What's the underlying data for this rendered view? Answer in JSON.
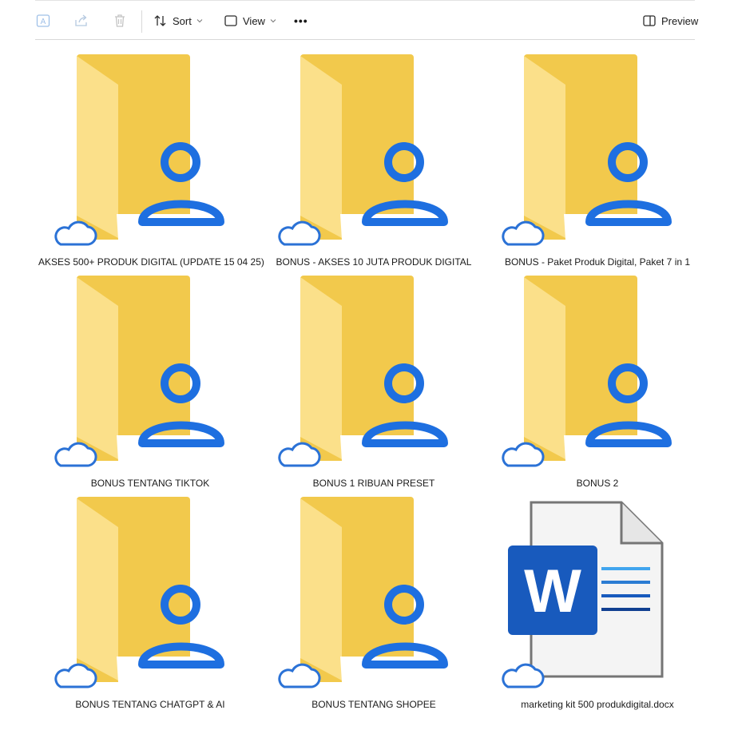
{
  "toolbar": {
    "rename_icon": "rename-icon",
    "share_icon": "share-icon",
    "delete_icon": "trash-icon",
    "sort_label": "Sort",
    "view_label": "View",
    "more_label": "•••",
    "preview_label": "Preview"
  },
  "items": [
    {
      "name": "AKSES 500+ PRODUK DIGITAL (UPDATE 15 04 25)",
      "type": "shared-folder",
      "status": "cloud"
    },
    {
      "name": "BONUS - AKSES 10 JUTA PRODUK DIGITAL",
      "type": "shared-folder",
      "status": "cloud"
    },
    {
      "name": "BONUS - Paket Produk Digital, Paket 7 in 1",
      "type": "shared-folder",
      "status": "cloud"
    },
    {
      "name": "BONUS  TENTANG TIKTOK",
      "type": "shared-folder",
      "status": "cloud"
    },
    {
      "name": "BONUS 1 RIBUAN PRESET",
      "type": "shared-folder",
      "status": "cloud"
    },
    {
      "name": "BONUS 2",
      "type": "shared-folder",
      "status": "cloud"
    },
    {
      "name": "BONUS TENTANG CHATGPT & AI",
      "type": "shared-folder",
      "status": "cloud"
    },
    {
      "name": "BONUS TENTANG SHOPEE",
      "type": "shared-folder",
      "status": "cloud"
    },
    {
      "name": "marketing kit 500 produkdigital.docx",
      "type": "word-document",
      "status": "cloud"
    }
  ],
  "colors": {
    "folder_back": "#f2c94c",
    "folder_front": "#fbe08a",
    "shared_badge": "#1e6fe0",
    "word_blue": "#185abd",
    "accent": "#0f6cbd"
  }
}
